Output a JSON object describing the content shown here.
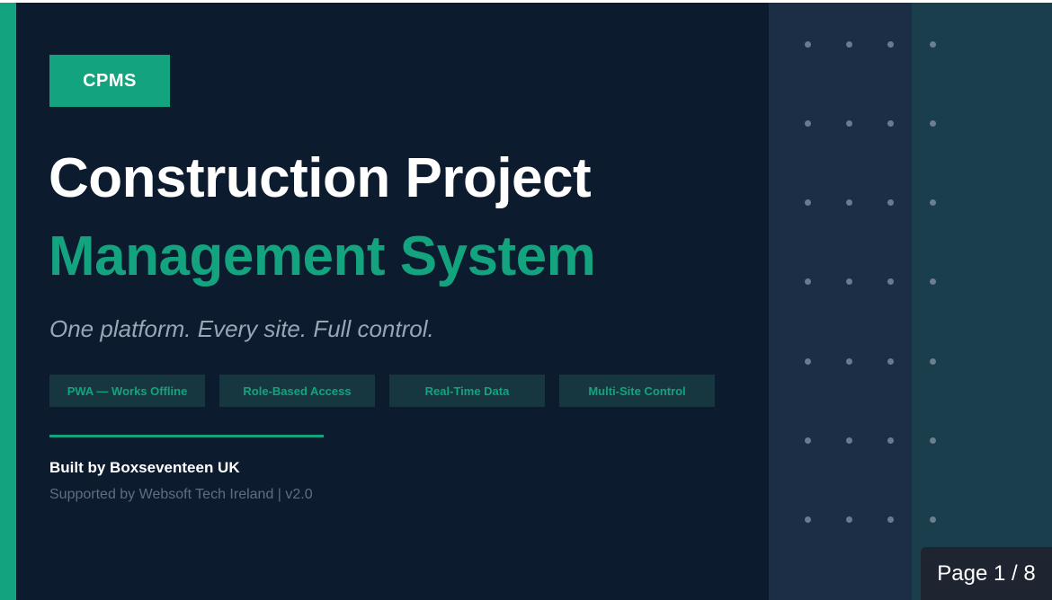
{
  "slide": {
    "badge": "CPMS",
    "title_line1": "Construction Project",
    "title_line2": "Management System",
    "tagline": "One platform. Every site. Full control.",
    "features": [
      "PWA — Works Offline",
      "Role-Based Access",
      "Real-Time Data",
      "Multi-Site Control"
    ],
    "built_by": "Built by Boxseventeen UK",
    "supported_by": "Supported by Websoft Tech Ireland  |  v2.0"
  },
  "viewer": {
    "page_indicator": "Page 1 / 8"
  },
  "colors": {
    "background": "#0d1b2e",
    "accent": "#14a37f",
    "panel_mid": "#1b2e46",
    "panel_right": "#1b3e4d"
  }
}
